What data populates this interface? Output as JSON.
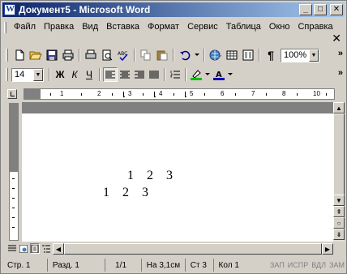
{
  "window": {
    "title": "Документ5 - Microsoft Word",
    "minimize": "_",
    "maximize": "□",
    "close": "✕"
  },
  "menu": {
    "items": [
      "Файл",
      "Правка",
      "Вид",
      "Вставка",
      "Формат",
      "Сервис",
      "Таблица",
      "Окно",
      "Справка"
    ],
    "close": "✕"
  },
  "standard_toolbar": {
    "zoom": "100%",
    "chevron": "»",
    "icons": [
      "new-document-icon",
      "open-icon",
      "save-icon",
      "print-preview-icon",
      "print-icon",
      "spelling-icon",
      "copy-icon",
      "paste-icon",
      "undo-icon",
      "hyperlink-icon",
      "tables-icon",
      "columns-icon",
      "show-formatting-icon"
    ]
  },
  "formatting_toolbar": {
    "font_size": "14",
    "bold": "Ж",
    "italic": "К",
    "underline": "Ч",
    "chevron": "»",
    "highlight_color": "#00c000",
    "font_color": "#0000c0"
  },
  "ruler": {
    "numbers": [
      "1",
      "1",
      "2",
      "3",
      "4",
      "5",
      "6",
      "7",
      "8",
      "9",
      "10"
    ]
  },
  "document": {
    "line1": "1    2    3",
    "line2": "1    2    3"
  },
  "status_bar": {
    "page": "Стр. 1",
    "section": "Разд. 1",
    "pages": "1/1",
    "at": "На 3,1см",
    "line": "Ст 3",
    "column": "Кол 1",
    "rec": "ЗАП",
    "trk": "ИСПР",
    "ext": "ВДЛ",
    "ovr": "ЗАМ"
  }
}
